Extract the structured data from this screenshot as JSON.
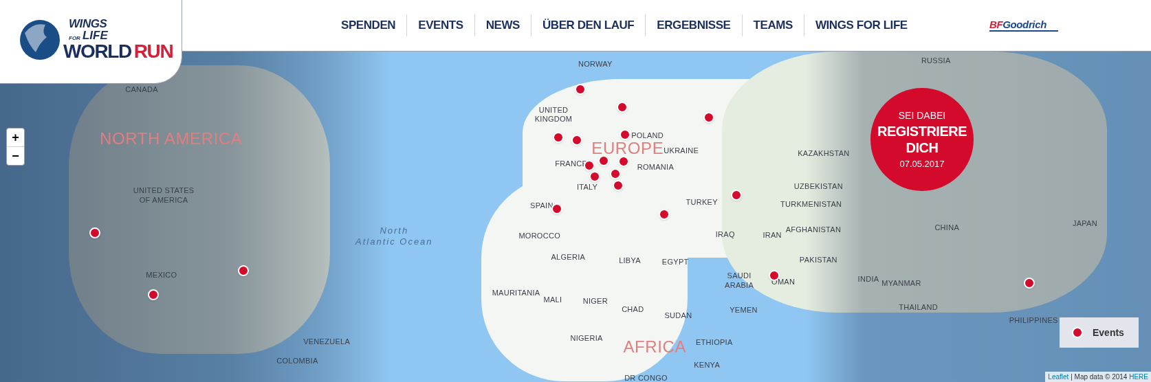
{
  "logo": {
    "wings": "WINGS",
    "for": "FOR",
    "life": "LIFE",
    "world": "WORLD",
    "run": "RUN"
  },
  "nav": [
    "SPENDEN",
    "EVENTS",
    "NEWS",
    "ÜBER DEN LAUF",
    "ERGEBNISSE",
    "TEAMS",
    "WINGS FOR LIFE"
  ],
  "sponsor": {
    "part_1": "BF",
    "part_2": "Goodrich"
  },
  "zoom_controls": [
    "+",
    "−"
  ],
  "map_labels": [
    {
      "text": "CANADA",
      "kind": "country"
    },
    {
      "text": "NORTH AMERICA",
      "kind": "continent"
    },
    {
      "text": "UNITED STATES\nOF AMERICA",
      "kind": "country"
    },
    {
      "text": "MEXICO",
      "kind": "country"
    },
    {
      "text": "VENEZUELA",
      "kind": "country"
    },
    {
      "text": "COLOMBIA",
      "kind": "country"
    },
    {
      "text": "North\nAtlantic Ocean",
      "kind": "ocean"
    },
    {
      "text": "NORWAY",
      "kind": "country"
    },
    {
      "text": "UNITED\nKINGDOM",
      "kind": "country"
    },
    {
      "text": "EUROPE",
      "kind": "continent"
    },
    {
      "text": "FRANCE",
      "kind": "country"
    },
    {
      "text": "ITALY",
      "kind": "country"
    },
    {
      "text": "POLAND",
      "kind": "country"
    },
    {
      "text": "UKRAINE",
      "kind": "country"
    },
    {
      "text": "ROMANIA",
      "kind": "country"
    },
    {
      "text": "SPAIN",
      "kind": "country"
    },
    {
      "text": "TURKEY",
      "kind": "country"
    },
    {
      "text": "KAZAKHSTAN",
      "kind": "country"
    },
    {
      "text": "UZBEKISTAN",
      "kind": "country"
    },
    {
      "text": "TURKMENISTAN",
      "kind": "country"
    },
    {
      "text": "RUSSIA",
      "kind": "country"
    },
    {
      "text": "AFGHANISTAN",
      "kind": "country"
    },
    {
      "text": "CHINA",
      "kind": "country"
    },
    {
      "text": "IRAQ",
      "kind": "country"
    },
    {
      "text": "IRAN",
      "kind": "country"
    },
    {
      "text": "PAKISTAN",
      "kind": "country"
    },
    {
      "text": "INDIA",
      "kind": "country"
    },
    {
      "text": "MYANMAR",
      "kind": "country"
    },
    {
      "text": "THAILAND",
      "kind": "country"
    },
    {
      "text": "JAPAN",
      "kind": "country"
    },
    {
      "text": "PHILIPPINES",
      "kind": "country"
    },
    {
      "text": "MOROCCO",
      "kind": "country"
    },
    {
      "text": "ALGERIA",
      "kind": "country"
    },
    {
      "text": "LIBYA",
      "kind": "country"
    },
    {
      "text": "EGYPT",
      "kind": "country"
    },
    {
      "text": "SAUDI\nARABIA",
      "kind": "country"
    },
    {
      "text": "OMAN",
      "kind": "country"
    },
    {
      "text": "YEMEN",
      "kind": "country"
    },
    {
      "text": "MAURITANIA",
      "kind": "country"
    },
    {
      "text": "MALI",
      "kind": "country"
    },
    {
      "text": "NIGER",
      "kind": "country"
    },
    {
      "text": "CHAD",
      "kind": "country"
    },
    {
      "text": "SUDAN",
      "kind": "country"
    },
    {
      "text": "NIGERIA",
      "kind": "country"
    },
    {
      "text": "AFRICA",
      "kind": "continent"
    },
    {
      "text": "ETHIOPIA",
      "kind": "country"
    },
    {
      "text": "KENYA",
      "kind": "country"
    },
    {
      "text": "DR CONGO",
      "kind": "country"
    }
  ],
  "cta": {
    "kicker": "SEI DABEI",
    "title": "REGISTRIERE DICH",
    "date": "07.05.2017"
  },
  "legend": {
    "label": "Events"
  },
  "attribution": {
    "link_1": "Leaflet",
    "text": "| Map data © 2014",
    "link_2": "HERE"
  }
}
